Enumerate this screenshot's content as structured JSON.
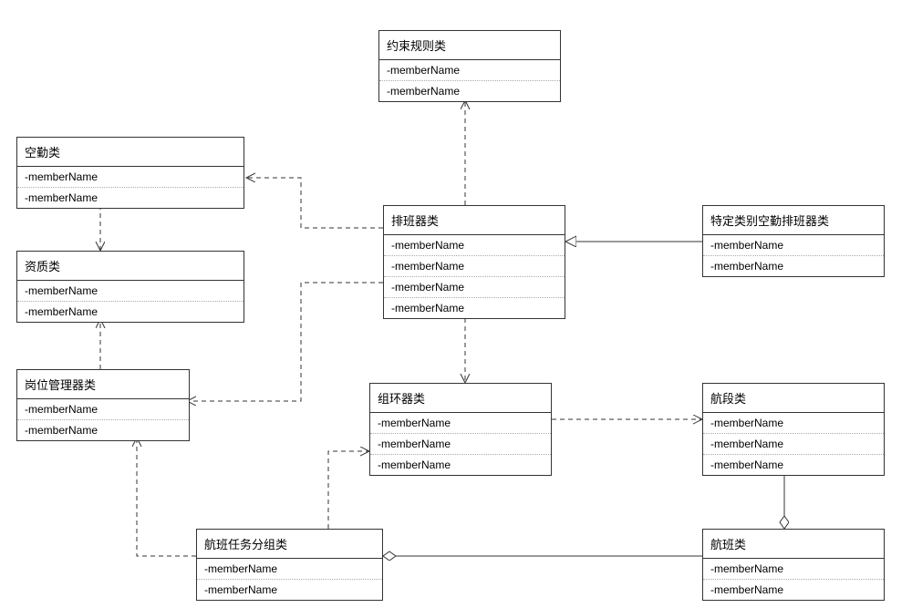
{
  "member_label": "-memberName",
  "classes": {
    "constraint_rule": {
      "title": "约束规则类",
      "members": 2
    },
    "aircrew": {
      "title": "空勤类",
      "members": 2
    },
    "qualification": {
      "title": "资质类",
      "members": 2
    },
    "position_manager": {
      "title": "岗位管理器类",
      "members": 2
    },
    "scheduler": {
      "title": "排班器类",
      "members": 4
    },
    "specific_scheduler": {
      "title": "特定类别空勤排班器类",
      "members": 2
    },
    "group_ring": {
      "title": "组环器类",
      "members": 3
    },
    "segment": {
      "title": "航段类",
      "members": 3
    },
    "flight_task_group": {
      "title": "航班任务分组类",
      "members": 2
    },
    "flight": {
      "title": "航班类",
      "members": 2
    }
  },
  "chart_data": {
    "type": "diagram",
    "notation": "UML class diagram",
    "nodes": [
      "约束规则类",
      "空勤类",
      "资质类",
      "岗位管理器类",
      "排班器类",
      "特定类别空勤排班器类",
      "组环器类",
      "航段类",
      "航班任务分组类",
      "航班类"
    ],
    "edges": [
      {
        "from": "排班器类",
        "to": "约束规则类",
        "type": "dependency"
      },
      {
        "from": "排班器类",
        "to": "空勤类",
        "type": "dependency"
      },
      {
        "from": "空勤类",
        "to": "资质类",
        "type": "dependency"
      },
      {
        "from": "岗位管理器类",
        "to": "资质类",
        "type": "dependency"
      },
      {
        "from": "排班器类",
        "to": "岗位管理器类",
        "type": "dependency"
      },
      {
        "from": "排班器类",
        "to": "组环器类",
        "type": "dependency"
      },
      {
        "from": "特定类别空勤排班器类",
        "to": "排班器类",
        "type": "generalization"
      },
      {
        "from": "组环器类",
        "to": "航段类",
        "type": "dependency"
      },
      {
        "from": "航段类",
        "to": "航班类",
        "type": "aggregation"
      },
      {
        "from": "航班类",
        "to": "航班任务分组类",
        "type": "aggregation"
      },
      {
        "from": "航班任务分组类",
        "to": "岗位管理器类",
        "type": "dependency"
      },
      {
        "from": "航班任务分组类",
        "to": "组环器类",
        "type": "dependency"
      }
    ]
  }
}
